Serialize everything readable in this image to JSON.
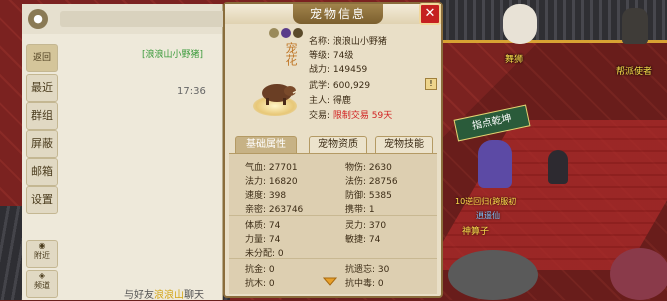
{
  "chat": {
    "target_label": "[浪浪山小野猪]",
    "time": "17:36",
    "footer_prefix": "与好友",
    "footer_friend": "浪浪山",
    "footer_suffix": "聊天",
    "sidebar": [
      {
        "label": "返回"
      },
      {
        "label": "最近"
      },
      {
        "label": "群组"
      },
      {
        "label": "屏蔽"
      },
      {
        "label": "邮箱"
      },
      {
        "label": "设置"
      },
      {
        "label": "附近"
      },
      {
        "label": "频道"
      }
    ]
  },
  "dialog": {
    "title": "宠物信息",
    "close": "✕",
    "pet_mark": "宠花",
    "info": {
      "name_label": "名称:",
      "name": "浪浪山小野猪",
      "level_label": "等级:",
      "level": "74级",
      "power_label": "战力:",
      "power": "149459",
      "martial_label": "武学:",
      "martial": "600,929",
      "owner_label": "主人:",
      "owner": "得鹿",
      "trade_label": "交易:",
      "trade": "限制交易 59天"
    },
    "warn": "!",
    "tabs": [
      "基础属性",
      "宠物资质",
      "宠物技能"
    ],
    "active_tab": 0,
    "stats": {
      "hp_label": "气血:",
      "hp": "27701",
      "phys_atk_label": "物伤:",
      "phys_atk": "2630",
      "mp_label": "法力:",
      "mp": "16820",
      "mag_atk_label": "法伤:",
      "mag_atk": "28756",
      "speed_label": "速度:",
      "speed": "398",
      "defense_label": "防御:",
      "defense": "5385",
      "intimacy_label": "亲密:",
      "intimacy": "263746",
      "carry_label": "携带:",
      "carry": "1",
      "con_label": "体质:",
      "con": "74",
      "spi_label": "灵力:",
      "spi": "370",
      "str_label": "力量:",
      "str": "74",
      "agi_label": "敏捷:",
      "agi": "74",
      "unalloc_label": "未分配:",
      "unalloc": "0",
      "res_earth_label": "抗金:",
      "res_earth": "0",
      "res_forget_label": "抗遗忘:",
      "res_forget": "30",
      "res_wood_label": "抗木:",
      "res_wood": "0",
      "res_poison_label": "抗中毒:",
      "res_poison": "0"
    }
  },
  "world": {
    "npc_dancer": "舞狮",
    "npc_guide": "帮派使者",
    "banner": "指点乾坤",
    "player_title": "逍遥仙",
    "player_name_a": "神算子",
    "player_tag_a": "10逆回归(跨服初",
    "player_tag_b": "逍遥仙",
    "npc_tag_c": "神算子"
  }
}
